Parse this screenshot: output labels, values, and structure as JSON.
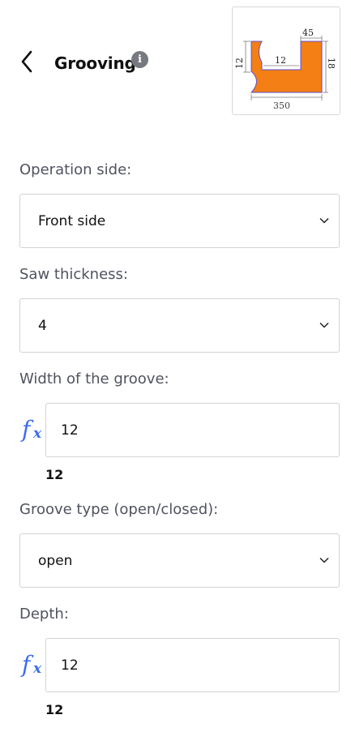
{
  "header": {
    "title": "Grooving",
    "info_glyph": "i"
  },
  "preview": {
    "dim_top": "45",
    "dim_left": "12",
    "dim_inner": "12",
    "dim_right": "18",
    "dim_bottom": "350",
    "fill_color": "#f47f14",
    "line_color": "#5b4fd6"
  },
  "fields": {
    "operation_side": {
      "label": "Operation side:",
      "value": "Front side"
    },
    "saw_thickness": {
      "label": "Saw thickness:",
      "value": "4"
    },
    "groove_width": {
      "label": "Width of the groove:",
      "value": "12",
      "computed": "12"
    },
    "groove_type": {
      "label": "Groove type (open/closed):",
      "value": "open"
    },
    "depth": {
      "label": "Depth:",
      "value": "12",
      "computed": "12"
    }
  },
  "colors": {
    "accent": "#3b6cf0",
    "label": "#505360",
    "border": "#d3d3d3"
  }
}
